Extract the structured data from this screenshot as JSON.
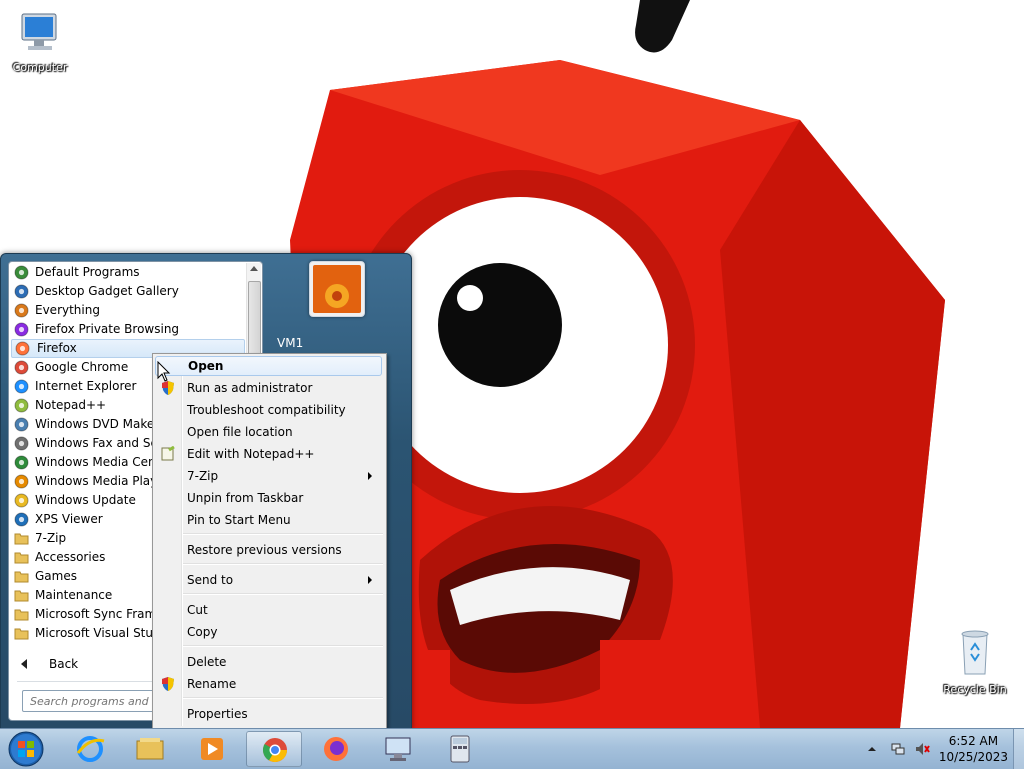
{
  "desktop": {
    "icons": [
      {
        "label": "Computer"
      },
      {
        "label": "Recycle Bin"
      }
    ]
  },
  "start_menu": {
    "programs": [
      {
        "label": "Default Programs",
        "icon": "default-programs-icon",
        "color": "#3a8c3a"
      },
      {
        "label": "Desktop Gadget Gallery",
        "icon": "gadget-icon",
        "color": "#2d6db5"
      },
      {
        "label": "Everything",
        "icon": "magnifier-icon",
        "color": "#d9791b"
      },
      {
        "label": "Firefox Private Browsing",
        "icon": "firefox-private-icon",
        "color": "#8a2be2"
      },
      {
        "label": "Firefox",
        "icon": "firefox-icon",
        "color": "#ff7139"
      },
      {
        "label": "Google Chrome",
        "icon": "chrome-icon",
        "color": "#dd4b39"
      },
      {
        "label": "Internet Explorer",
        "icon": "ie-icon",
        "color": "#1e90ff"
      },
      {
        "label": "Notepad++",
        "icon": "notepadpp-icon",
        "color": "#8fbc3f"
      },
      {
        "label": "Windows DVD Maker",
        "icon": "dvd-icon",
        "color": "#4a7fb0"
      },
      {
        "label": "Windows Fax and Scan",
        "icon": "fax-icon",
        "color": "#707070"
      },
      {
        "label": "Windows Media Center",
        "icon": "media-center-icon",
        "color": "#2e8b3a"
      },
      {
        "label": "Windows Media Player",
        "icon": "media-player-icon",
        "color": "#e68a00"
      },
      {
        "label": "Windows Update",
        "icon": "update-icon",
        "color": "#e8b923"
      },
      {
        "label": "XPS Viewer",
        "icon": "xps-icon",
        "color": "#1f6fb8"
      },
      {
        "label": "7-Zip",
        "icon": "folder-icon",
        "color": "#e8c15a"
      },
      {
        "label": "Accessories",
        "icon": "folder-icon",
        "color": "#e8c15a"
      },
      {
        "label": "Games",
        "icon": "folder-icon",
        "color": "#e8c15a"
      },
      {
        "label": "Maintenance",
        "icon": "folder-icon",
        "color": "#e8c15a"
      },
      {
        "label": "Microsoft Sync Framework",
        "icon": "folder-icon",
        "color": "#e8c15a"
      },
      {
        "label": "Microsoft Visual Studio",
        "icon": "folder-icon",
        "color": "#e8c15a"
      }
    ],
    "highlighted": "Firefox",
    "back_label": "Back",
    "search_placeholder": "Search programs and files",
    "user_name": "VM1"
  },
  "context_menu": {
    "items": [
      {
        "label": "Open",
        "bold": true,
        "highlighted": true
      },
      {
        "label": "Run as administrator",
        "icon": "uac-shield-icon"
      },
      {
        "label": "Troubleshoot compatibility"
      },
      {
        "label": "Open file location"
      },
      {
        "label": "Edit with Notepad++",
        "icon": "notepadpp-icon"
      },
      {
        "label": "7-Zip",
        "submenu": true
      },
      {
        "label": "Unpin from Taskbar"
      },
      {
        "label": "Pin to Start Menu"
      },
      {
        "label": "Restore previous versions"
      },
      {
        "label": "Send to",
        "submenu": true
      },
      {
        "label": "Cut"
      },
      {
        "label": "Copy"
      },
      {
        "label": "Delete"
      },
      {
        "label": "Rename",
        "icon": "uac-shield-icon"
      },
      {
        "label": "Properties"
      }
    ]
  },
  "taskbar": {
    "pinned": [
      {
        "name": "internet-explorer"
      },
      {
        "name": "windows-explorer"
      },
      {
        "name": "media-player"
      },
      {
        "name": "google-chrome",
        "active": true
      },
      {
        "name": "firefox"
      },
      {
        "name": "remote-desktop"
      },
      {
        "name": "calculator"
      }
    ],
    "clock": {
      "time": "6:52 AM",
      "date": "10/25/2023"
    }
  }
}
